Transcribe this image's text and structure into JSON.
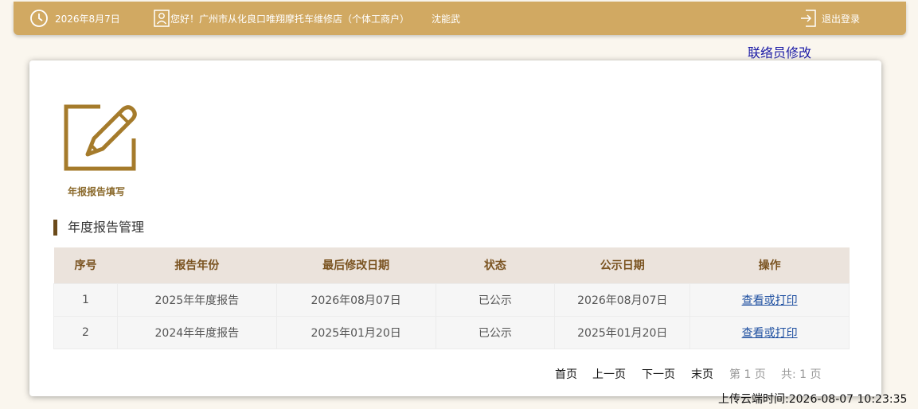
{
  "header": {
    "date": "2026年8月7日",
    "greeting": "您好！广州市从化良口唯翔摩托车维修店（个体工商户）",
    "user": "沈能武",
    "logout_label": "退出登录"
  },
  "contact_modify_link": "联络员修改",
  "tile": {
    "label": "年报报告填写",
    "icon": "edit-icon"
  },
  "section_title": "年度报告管理",
  "table": {
    "columns": [
      "序号",
      "报告年份",
      "最后修改日期",
      "状态",
      "公示日期",
      "操作"
    ],
    "rows": [
      {
        "index": "1",
        "year": "2025年年度报告",
        "modified": "2026年08月07日",
        "status": "已公示",
        "publish_date": "2026年08月07日",
        "action": "查看或打印"
      },
      {
        "index": "2",
        "year": "2024年年度报告",
        "modified": "2025年01月20日",
        "status": "已公示",
        "publish_date": "2025年01月20日",
        "action": "查看或打印"
      }
    ]
  },
  "pager": {
    "first": "首页",
    "prev": "上一页",
    "next": "下一页",
    "last": "末页",
    "current": "第 1 页",
    "total": "共:  1 页"
  },
  "upload_time": "上传云端时间:2026-08-07 10:23:35",
  "colors": {
    "header_bg": "#d1a962",
    "accent_brown": "#a57b2b",
    "table_header_bg": "#ebe3dc",
    "link_blue": "#1e4fa0"
  }
}
